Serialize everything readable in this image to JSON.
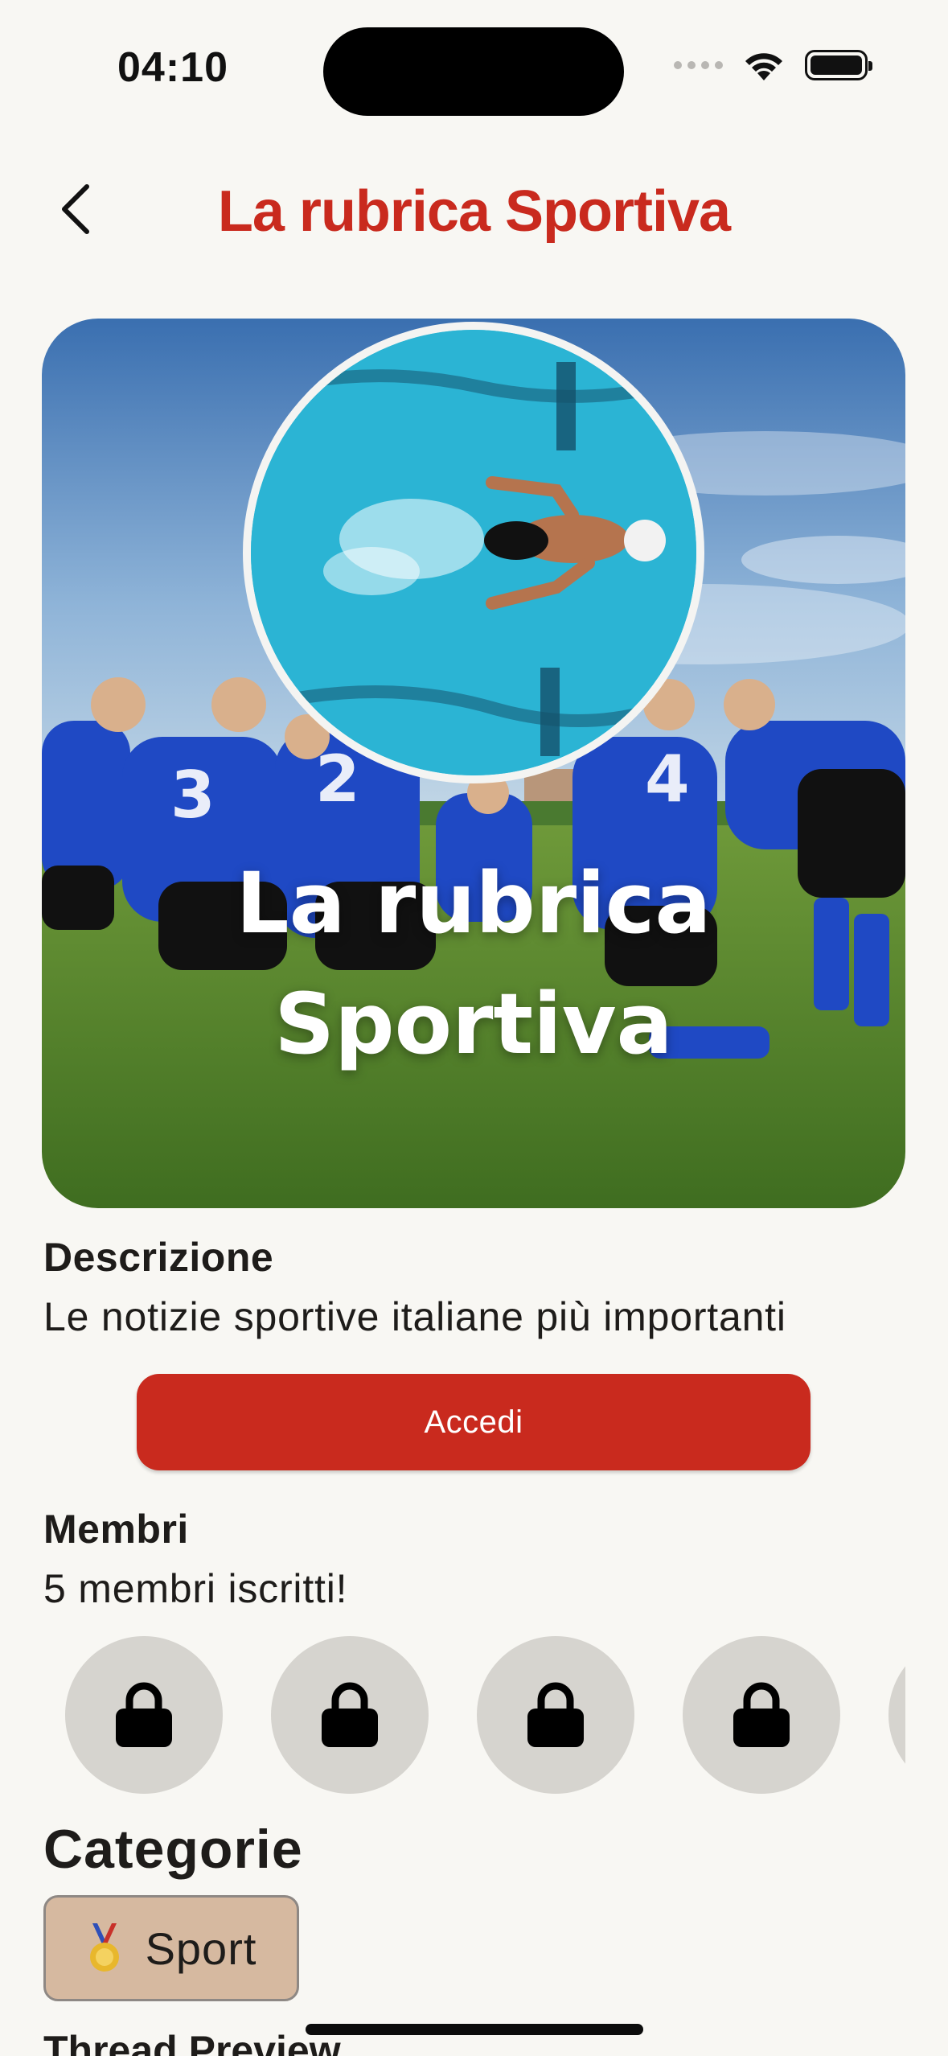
{
  "status_bar": {
    "time": "04:10"
  },
  "nav": {
    "title": "La rubrica Sportiva"
  },
  "hero": {
    "title_line1": "La rubrica",
    "title_line2": "Sportiva"
  },
  "description": {
    "label": "Descrizione",
    "text": "Le notizie sportive italiane più importanti"
  },
  "join": {
    "label": "Accedi"
  },
  "members": {
    "label": "Membri",
    "count_text": "5 membri iscritti!",
    "avatar_icon": "lock-icon"
  },
  "categories": {
    "title": "Categorie",
    "items": [
      {
        "icon": "medal-icon",
        "label": "Sport"
      }
    ]
  },
  "thread_preview": {
    "title": "Thread Preview"
  },
  "colors": {
    "accent": "#c92a1e",
    "background": "#f8f7f3",
    "chip": "#d6b9a0",
    "avatar_bg": "#d6d4cf"
  }
}
